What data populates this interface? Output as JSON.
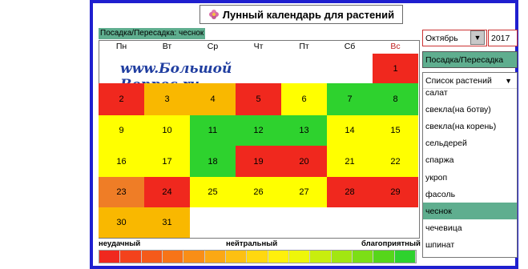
{
  "app": {
    "title": "Лунный календарь для растений",
    "subtitle": "Посадка/Пересадка: чеснок",
    "watermark": "www.Большой Вопрос.ru"
  },
  "weekdays": [
    {
      "label": "Пн",
      "color": "#000000"
    },
    {
      "label": "Вт",
      "color": "#000000"
    },
    {
      "label": "Ср",
      "color": "#000000"
    },
    {
      "label": "Чт",
      "color": "#000000"
    },
    {
      "label": "Пт",
      "color": "#000000"
    },
    {
      "label": "Сб",
      "color": "#000000"
    },
    {
      "label": "Вс",
      "color": "#c02020"
    }
  ],
  "colors": {
    "bad": "#f0281e",
    "orange": "#f59e0b",
    "yellow": "#ffff00",
    "green": "#2ed22e",
    "darkorange": "#ef7d26",
    "accent_green": "#5fae8f"
  },
  "calendar": {
    "month": "Октябрь",
    "year": "2017",
    "days": [
      {
        "day": "1",
        "color": "#f0281e"
      },
      {
        "day": "2",
        "color": "#f0281e"
      },
      {
        "day": "3",
        "color": "#f9b800"
      },
      {
        "day": "4",
        "color": "#f9b800"
      },
      {
        "day": "5",
        "color": "#f0281e"
      },
      {
        "day": "6",
        "color": "#ffff00"
      },
      {
        "day": "7",
        "color": "#2ed22e"
      },
      {
        "day": "8",
        "color": "#2ed22e"
      },
      {
        "day": "9",
        "color": "#ffff00"
      },
      {
        "day": "10",
        "color": "#ffff00"
      },
      {
        "day": "11",
        "color": "#2ed22e"
      },
      {
        "day": "12",
        "color": "#2ed22e"
      },
      {
        "day": "13",
        "color": "#2ed22e"
      },
      {
        "day": "14",
        "color": "#ffff00"
      },
      {
        "day": "15",
        "color": "#ffff00"
      },
      {
        "day": "16",
        "color": "#ffff00"
      },
      {
        "day": "17",
        "color": "#ffff00"
      },
      {
        "day": "18",
        "color": "#2ed22e"
      },
      {
        "day": "19",
        "color": "#f0281e"
      },
      {
        "day": "20",
        "color": "#f0281e"
      },
      {
        "day": "21",
        "color": "#ffff00"
      },
      {
        "day": "22",
        "color": "#ffff00"
      },
      {
        "day": "23",
        "color": "#ef7d26"
      },
      {
        "day": "24",
        "color": "#f0281e"
      },
      {
        "day": "25",
        "color": "#ffff00"
      },
      {
        "day": "26",
        "color": "#ffff00"
      },
      {
        "day": "27",
        "color": "#ffff00"
      },
      {
        "day": "28",
        "color": "#f0281e"
      },
      {
        "day": "29",
        "color": "#f0281e"
      },
      {
        "day": "30",
        "color": "#f9b800"
      },
      {
        "day": "31",
        "color": "#f9b800"
      }
    ]
  },
  "legend": {
    "bad_label": "неудачный",
    "neutral_label": "нейтральный",
    "good_label": "благоприятный",
    "gradient": [
      "#f0281e",
      "#f3421c",
      "#f55a1a",
      "#f77418",
      "#f98e16",
      "#fba814",
      "#fdc012",
      "#ffd80f",
      "#fff00c",
      "#eef60a",
      "#c8ee0e",
      "#a2e612",
      "#7cde16",
      "#56d61a",
      "#2ed22e"
    ]
  },
  "controls": {
    "month_value": "Октябрь",
    "year_value": "2017",
    "action_value": "Посадка/Пересадка",
    "plant_list_header": "Список растений",
    "plants": [
      "салат",
      "свекла(на ботву)",
      "свекла(на корень)",
      "сельдерей",
      "спаржа",
      "укроп",
      "фасоль",
      "чеснок",
      "чечевица",
      "шпинат"
    ],
    "selected_plant": "чеснок"
  }
}
